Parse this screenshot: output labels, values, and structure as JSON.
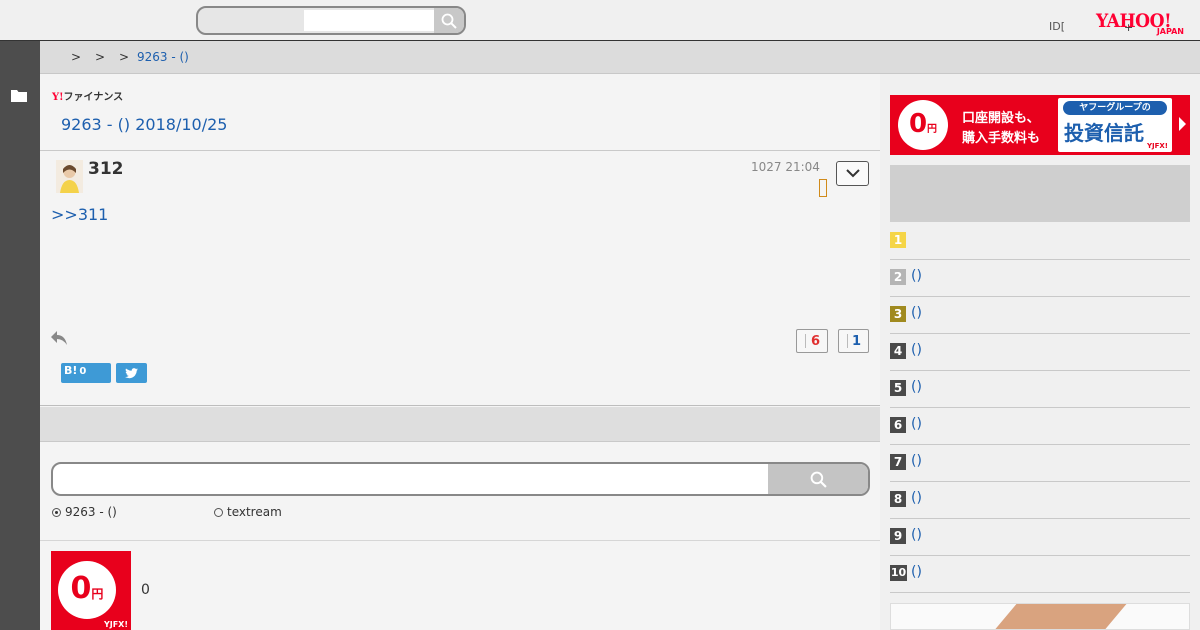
{
  "header": {
    "search_placeholder": "",
    "id_label": "ID[",
    "plus_label": "+",
    "logo_text": "YAHOO!",
    "logo_sub": "JAPAN"
  },
  "breadcrumb": {
    "sep1": ">",
    "sep2": ">",
    "sep3": ">",
    "current": "9263 - ()"
  },
  "main": {
    "finance_logo_y": "Y!",
    "finance_logo_text": "ファイナンス",
    "thread_title": "9263 - () 2018/10/25",
    "post": {
      "number": "312",
      "time": "1027 21:04",
      "body_link": ">>311",
      "bad_count": "6",
      "good_count": "1",
      "hatena_label": "B!",
      "hatena_count": "0"
    },
    "search": {
      "placeholder": "",
      "option1": "9263 - ()",
      "option2": "textream"
    },
    "ad": {
      "zero": "0",
      "yen": "円",
      "brand": "YJFX!",
      "text": "0"
    }
  },
  "sidebar": {
    "banner": {
      "zero": "0",
      "yen": "円",
      "line1": "口座開設も、",
      "line2": "購入手数料も",
      "group": "ヤフーグループの",
      "big": "投資信託",
      "brand": "YJFX!"
    },
    "ranking": [
      {
        "rank": "1",
        "label": "",
        "color": "#f5d547"
      },
      {
        "rank": "2",
        "label": "()",
        "color": "#b5b5b5"
      },
      {
        "rank": "3",
        "label": "()",
        "color": "#a08a1f"
      },
      {
        "rank": "4",
        "label": "()",
        "color": "#4a4a4a"
      },
      {
        "rank": "5",
        "label": "()",
        "color": "#4a4a4a"
      },
      {
        "rank": "6",
        "label": "()",
        "color": "#4a4a4a"
      },
      {
        "rank": "7",
        "label": "()",
        "color": "#4a4a4a"
      },
      {
        "rank": "8",
        "label": "()",
        "color": "#4a4a4a"
      },
      {
        "rank": "9",
        "label": "()",
        "color": "#4a4a4a"
      },
      {
        "rank": "10",
        "label": "()",
        "color": "#4a4a4a"
      }
    ]
  },
  "colors": {
    "link": "#1d5fae",
    "brand_red": "#ff0033",
    "ad_red": "#e8001c"
  }
}
